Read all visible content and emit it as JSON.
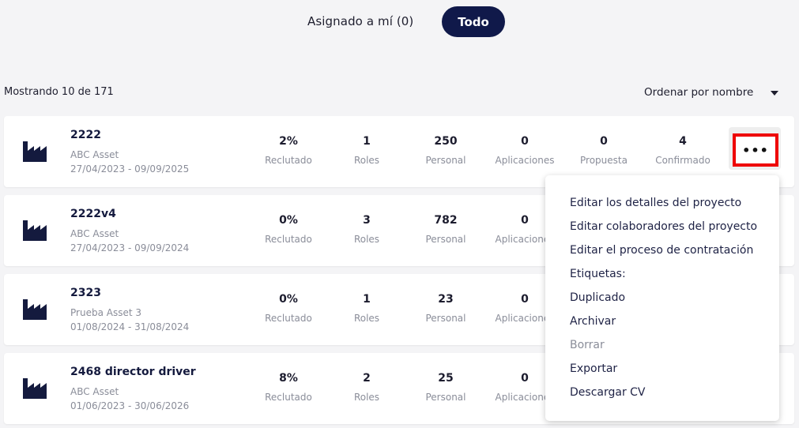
{
  "filters": {
    "assigned_label": "Asignado a mí (0)",
    "all_label": "Todo"
  },
  "results": {
    "count_text": "Mostrando 10 de 171",
    "sort_label": "Ordenar por nombre"
  },
  "colors": {
    "accent": "#10194a",
    "highlight": "#ee0000"
  },
  "icons": {
    "project": "factory-icon",
    "more": "more-horizontal-icon",
    "sort": "caret-down-icon"
  },
  "stat_labels": {
    "recruited": "Reclutado",
    "roles": "Roles",
    "staff": "Personal",
    "applications": "Aplicaciones",
    "proposal": "Propuesta",
    "confirmed": "Confirmado"
  },
  "projects": [
    {
      "title": "2222",
      "client": "ABC Asset",
      "dates": "27/04/2023 - 09/09/2025",
      "recruited": "2%",
      "roles": "1",
      "staff": "250",
      "applications": "0",
      "proposal": "0",
      "confirmed": "4"
    },
    {
      "title": "2222v4",
      "client": "ABC Asset",
      "dates": "27/04/2023 - 09/09/2024",
      "recruited": "0%",
      "roles": "3",
      "staff": "782",
      "applications": "0"
    },
    {
      "title": "2323",
      "client": "Prueba Asset 3",
      "dates": "01/08/2024 - 31/08/2024",
      "recruited": "0%",
      "roles": "1",
      "staff": "23",
      "applications": "0"
    },
    {
      "title": "2468 director driver",
      "client": "ABC Asset",
      "dates": "01/06/2023 - 30/06/2026",
      "recruited": "8%",
      "roles": "2",
      "staff": "25",
      "applications": "0"
    }
  ],
  "more_button_label": "•••",
  "menu": {
    "items": [
      {
        "label": "Editar los detalles del proyecto",
        "disabled": false
      },
      {
        "label": "Editar colaboradores del proyecto",
        "disabled": false
      },
      {
        "label": "Editar el proceso de contratación",
        "disabled": false
      },
      {
        "label": "Etiquetas:",
        "disabled": false
      },
      {
        "label": "Duplicado",
        "disabled": false
      },
      {
        "label": "Archivar",
        "disabled": false
      },
      {
        "label": "Borrar",
        "disabled": true
      },
      {
        "label": "Exportar",
        "disabled": false
      },
      {
        "label": "Descargar CV",
        "disabled": false
      }
    ]
  }
}
